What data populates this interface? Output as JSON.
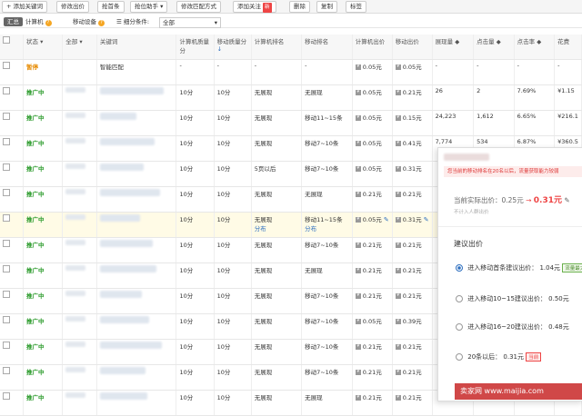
{
  "toolbar": {
    "items": [
      {
        "label": "添加关键词",
        "icon": "plus-icon"
      },
      {
        "label": "修改出价"
      },
      {
        "label": "抢首条"
      },
      {
        "label": "抢位助手",
        "icon": "chevron-down-icon"
      },
      {
        "label": "修改匹配方式"
      },
      {
        "label": "添加关注",
        "badge": "新"
      },
      {
        "label": "删除"
      },
      {
        "label": "复制"
      },
      {
        "label": "标签"
      }
    ]
  },
  "tabs": {
    "summary": "汇总",
    "computer": "计算机",
    "mobile": "移动设备",
    "filter_label": "细分条件:",
    "filter_value": "全部"
  },
  "columns": {
    "status": "状态",
    "all": "全部",
    "keyword": "关键词",
    "pc_quality": "计算机质量分",
    "mobile_quality": "移动质量分",
    "pc_rank": "计算机排名",
    "mobile_rank": "移动排名",
    "pc_bid": "计算机出价",
    "mobile_bid": "移动出价",
    "impressions": "展现量",
    "clicks": "点击量",
    "ctr": "点击率",
    "spend": "花费"
  },
  "rows": [
    {
      "status": "暂停",
      "keyword": "智能匹配",
      "pcq": "-",
      "mq": "-",
      "pcr": "-",
      "mr": "-",
      "pcb": "0.05元",
      "mb": "0.05元",
      "imp": "-",
      "clk": "-",
      "ctr": "-",
      "cost": "-"
    },
    {
      "status": "推广中",
      "keyword": "",
      "pcq": "10分",
      "mq": "10分",
      "pcr": "无展现",
      "mr": "无展现",
      "pcb": "0.05元",
      "mb": "0.21元",
      "imp": "26",
      "clk": "2",
      "ctr": "7.69%",
      "cost": "¥1.15"
    },
    {
      "status": "推广中",
      "keyword": "",
      "pcq": "10分",
      "mq": "10分",
      "pcr": "无展现",
      "mr": "移动11~15条",
      "pcb": "0.05元",
      "mb": "0.15元",
      "imp": "24,223",
      "clk": "1,612",
      "ctr": "6.65%",
      "cost": "¥216.1"
    },
    {
      "status": "推广中",
      "keyword": "",
      "pcq": "10分",
      "mq": "10分",
      "pcr": "无展现",
      "mr": "移动7~10条",
      "pcb": "0.05元",
      "mb": "0.41元",
      "imp": "7,774",
      "clk": "534",
      "ctr": "6.87%",
      "cost": "¥360.5"
    },
    {
      "status": "推广中",
      "keyword": "",
      "pcq": "10分",
      "mq": "10分",
      "pcr": "5页以后",
      "mr": "移动7~10条",
      "pcb": "0.05元",
      "mb": "0.31元",
      "imp": "",
      "clk": "",
      "ctr": "",
      "cost": ""
    },
    {
      "status": "推广中",
      "keyword": "",
      "pcq": "10分",
      "mq": "10分",
      "pcr": "无展现",
      "mr": "无展现",
      "pcb": "0.21元",
      "mb": "0.21元",
      "imp": "",
      "clk": "",
      "ctr": "",
      "cost": ""
    },
    {
      "status": "推广中",
      "keyword": "",
      "pcq": "10分",
      "mq": "10分",
      "pcr": "无展现",
      "pcr2": "分布",
      "mr": "移动11~15条",
      "mr2": "分布",
      "pcb": "0.05元",
      "mb": "0.31元",
      "imp": "",
      "clk": "",
      "ctr": "",
      "cost": "",
      "hl": true
    },
    {
      "status": "推广中",
      "keyword": "",
      "pcq": "10分",
      "mq": "10分",
      "pcr": "无展现",
      "mr": "移动7~10条",
      "pcb": "0.21元",
      "mb": "0.21元",
      "imp": "",
      "clk": "",
      "ctr": "",
      "cost": ""
    },
    {
      "status": "推广中",
      "keyword": "",
      "pcq": "10分",
      "mq": "10分",
      "pcr": "无展现",
      "mr": "无展现",
      "pcb": "0.21元",
      "mb": "0.21元",
      "imp": "",
      "clk": "",
      "ctr": "",
      "cost": ""
    },
    {
      "status": "推广中",
      "keyword": "",
      "pcq": "10分",
      "mq": "10分",
      "pcr": "无展现",
      "mr": "移动7~10条",
      "pcb": "0.21元",
      "mb": "0.21元",
      "imp": "",
      "clk": "",
      "ctr": "",
      "cost": ""
    },
    {
      "status": "推广中",
      "keyword": "",
      "pcq": "10分",
      "mq": "10分",
      "pcr": "无展现",
      "mr": "移动7~10条",
      "pcb": "0.05元",
      "mb": "0.39元",
      "imp": "",
      "clk": "",
      "ctr": "",
      "cost": ""
    },
    {
      "status": "推广中",
      "keyword": "",
      "pcq": "10分",
      "mq": "10分",
      "pcr": "无展现",
      "mr": "移动7~10条",
      "pcb": "0.21元",
      "mb": "0.21元",
      "imp": "",
      "clk": "",
      "ctr": "",
      "cost": ""
    },
    {
      "status": "推广中",
      "keyword": "",
      "pcq": "10分",
      "mq": "10分",
      "pcr": "无展现",
      "mr": "移动7~10条",
      "pcb": "0.21元",
      "mb": "0.21元",
      "imp": "",
      "clk": "",
      "ctr": "",
      "cost": ""
    },
    {
      "status": "推广中",
      "keyword": "",
      "pcq": "10分",
      "mq": "10分",
      "pcr": "无展现",
      "mr": "无展现",
      "pcb": "0.21元",
      "mb": "0.21元",
      "imp": "",
      "clk": "",
      "ctr": "",
      "cost": ""
    }
  ],
  "panel": {
    "hint": "您当前的移动排名在20名以后，流量获取能力较弱",
    "current_label": "当前实际出价：0.25元",
    "arrow": "→",
    "new_bid": "0.31元",
    "sub": "不计入人群出价",
    "suggest_title": "建议出价",
    "options": [
      {
        "label": "进入移动首条建议出价：",
        "value": "1.04元",
        "tag": "流量最大",
        "selected": true
      },
      {
        "label": "进入移动10~15建议出价：",
        "value": "0.50元"
      },
      {
        "label": "进入移动16~20建议出价：",
        "value": "0.48元"
      },
      {
        "label": "20条以后：",
        "value": "0.31元",
        "tag": "当前"
      }
    ]
  },
  "watermark": "卖家网 www.maijia.com"
}
